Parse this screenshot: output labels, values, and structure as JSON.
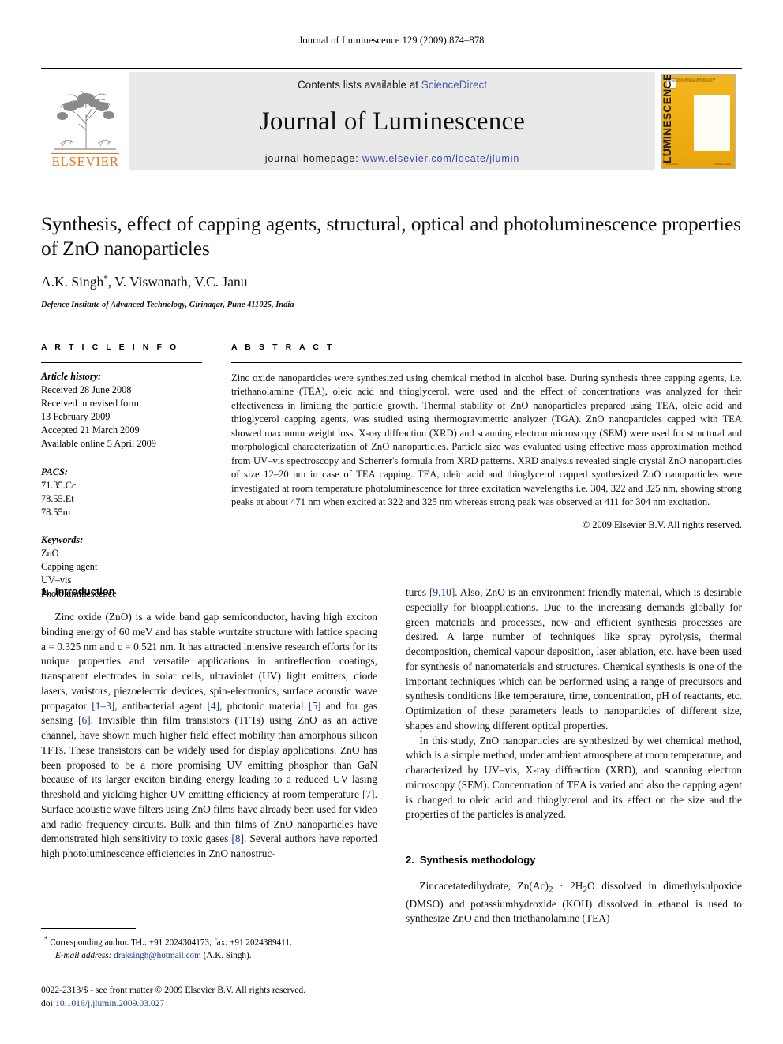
{
  "running_head": "Journal of Luminescence 129 (2009) 874–878",
  "masthead": {
    "publisher_name": "ELSEVIER",
    "contents_prefix": "Contents lists available at ",
    "contents_link": "ScienceDirect",
    "journal_title": "Journal of Luminescence",
    "homepage_prefix": "journal homepage: ",
    "homepage_url": "www.elsevier.com/locate/jlumin",
    "cover": {
      "vertical_title": "LUMINESCENCE",
      "vertical_sub": "JOURNAL OF",
      "top_text": "INTERNATIONAL JOURNAL OF RESEARCH ON THE SPECTROSCOPY OF LUMINESCENT MATERIALS",
      "bottom_left": "ScienceDirect",
      "bottom_right": "Available online at"
    }
  },
  "title": "Synthesis, effect of capping agents, structural, optical and photoluminescence properties of ZnO nanoparticles",
  "authors": "A.K. Singh",
  "authors_rest": ", V. Viswanath, V.C. Janu",
  "author_marker": "*",
  "affiliation": "Defence Institute of Advanced Technology, Girinagar, Pune 411025, India",
  "article_info": {
    "label": "A R T I C L E   I N F O",
    "history_label": "Article history:",
    "history": [
      "Received 28 June 2008",
      "Received in revised form",
      "13 February 2009",
      "Accepted 21 March 2009",
      "Available online 5 April 2009"
    ],
    "pacs_label": "PACS:",
    "pacs": [
      "71.35.Cc",
      "78.55.Et",
      "78.55m"
    ],
    "keywords_label": "Keywords:",
    "keywords": [
      "ZnO",
      "Capping agent",
      "UV–vis",
      "Photoluminescence"
    ]
  },
  "abstract": {
    "label": "A B S T R A C T",
    "text": "Zinc oxide nanoparticles were synthesized using chemical method in alcohol base. During synthesis three capping agents, i.e. triethanolamine (TEA), oleic acid and thioglycerol, were used and the effect of concentrations was analyzed for their effectiveness in limiting the particle growth. Thermal stability of ZnO nanoparticles prepared using TEA, oleic acid and thioglycerol capping agents, was studied using thermogravimetric analyzer (TGA). ZnO nanoparticles capped with TEA showed maximum weight loss. X-ray diffraction (XRD) and scanning electron microscopy (SEM) were used for structural and morphological characterization of ZnO nanoparticles. Particle size was evaluated using effective mass approximation method from UV–vis spectroscopy and Scherrer's formula from XRD patterns. XRD analysis revealed single crystal ZnO nanoparticles of size 12–20 nm in case of TEA capping. TEA, oleic acid and thioglycerol capped synthesized ZnO nanoparticles were investigated at room temperature photoluminescence for three excitation wavelengths i.e. 304, 322 and 325 nm, showing strong peaks at about 471 nm when excited at 322 and 325 nm whereas strong peak was observed at 411 for 304 nm excitation.",
    "copyright": "© 2009 Elsevier B.V. All rights reserved."
  },
  "sections": {
    "intro_num": "1.",
    "intro_title": "Introduction",
    "synthesis_num": "2.",
    "synthesis_title": "Synthesis methodology"
  },
  "body": {
    "left_p1_a": "Zinc oxide (ZnO) is a wide band gap semiconductor, having high exciton binding energy of 60 meV and has stable wurtzite structure with lattice spacing a = 0.325 nm and c = 0.521 nm. It has attracted intensive research efforts for its unique properties and versatile applications in antireflection coatings, transparent electrodes in solar cells, ultraviolet (UV) light emitters, diode lasers, varistors, piezoelectric devices, spin-electronics, surface acoustic wave propagator ",
    "ref_1_3": "[1–3]",
    "left_p1_b": ", antibacterial agent ",
    "ref_4": "[4]",
    "left_p1_c": ", photonic material ",
    "ref_5": "[5]",
    "left_p1_d": " and for gas sensing ",
    "ref_6": "[6]",
    "left_p1_e": ". Invisible thin film transistors (TFTs) using ZnO as an active channel, have shown much higher field effect mobility than amorphous silicon TFTs. These transistors can be widely used for display applications. ZnO has been proposed to be a more promising UV emitting phosphor than GaN because of its larger exciton binding energy leading to a reduced UV lasing threshold and yielding higher UV emitting efficiency at room temperature ",
    "ref_7": "[7]",
    "left_p1_f": ". Surface acoustic wave filters using ZnO films have already been used for video and radio frequency circuits. Bulk and thin films of ZnO nanoparticles have demonstrated high sensitivity to toxic gases ",
    "ref_8": "[8]",
    "left_p1_g": ". Several authors have reported high photoluminescence efficiencies in ZnO nanostruc-",
    "right_p1_a": "tures ",
    "ref_9_10": "[9,10]",
    "right_p1_b": ". Also, ZnO is an environment friendly material, which is desirable especially for bioapplications. Due to the increasing demands globally for green materials and processes, new and efficient synthesis processes are desired. A large number of techniques like spray pyrolysis, thermal decomposition, chemical vapour deposition, laser ablation, etc. have been used for synthesis of nanomaterials and structures. Chemical synthesis is one of the important techniques which can be performed using a range of precursors and synthesis conditions like temperature, time, concentration, pH of reactants, etc. Optimization of these parameters leads to nanoparticles of different size, shapes and showing different optical properties.",
    "right_p2": "In this study, ZnO nanoparticles are synthesized by wet chemical method, which is a simple method, under ambient atmosphere at room temperature, and characterized by UV–vis, X-ray diffraction (XRD), and scanning electron microscopy (SEM). Concentration of TEA is varied and also the capping agent is changed to oleic acid and thioglycerol and its effect on the size and the properties of the particles is analyzed.",
    "right_p3_a": "Zincacetatedihydrate, Zn(Ac)",
    "right_p3_sub1": "2",
    "right_p3_b": " · 2H",
    "right_p3_sub2": "2",
    "right_p3_c": "O dissolved in dimethylsulpoxide (DMSO) and potassiumhydroxide (KOH) dissolved in ethanol is used to synthesize ZnO and then triethanolamine (TEA)"
  },
  "footnote": {
    "corresponding": "Corresponding author. Tel.: +91 2024304173; fax: +91 2024389411.",
    "email_label": "E-mail address:",
    "email": "draksingh@hotmail.com",
    "email_owner": "(A.K. Singh)."
  },
  "imprint": {
    "issn_line": "0022-2313/$ - see front matter © 2009 Elsevier B.V. All rights reserved.",
    "doi_label": "doi:",
    "doi": "10.1016/j.jlumin.2009.03.027"
  }
}
